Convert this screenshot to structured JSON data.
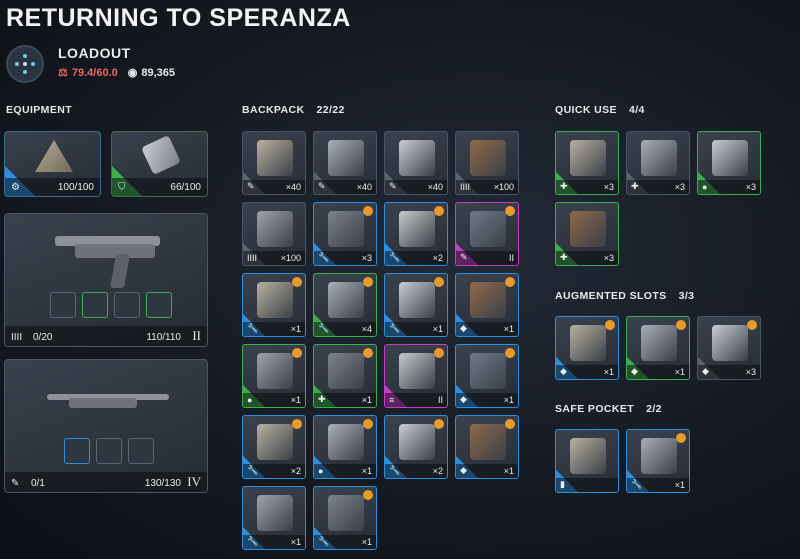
{
  "header": {
    "title": "RETURNING TO SPERANZA",
    "loadout_label": "LOADOUT",
    "weight": "79.4/60.0",
    "coins": "89,365"
  },
  "colors": {
    "blue": "#2f8fdf",
    "green": "#3cae4f",
    "purple": "#c43ec6",
    "gray": "#5b6370",
    "gold": "#e89a2c",
    "weight": "#e76a5c"
  },
  "equipment": {
    "label": "EQUIPMENT",
    "augment": {
      "value": "100/100",
      "icon": "augment-icon"
    },
    "shield": {
      "value": "66/100",
      "icon": "shield-icon"
    },
    "weapon1": {
      "ammo": "0/20",
      "durability": "110/110",
      "tier": "II",
      "mods": [
        "mod-a",
        "mod-b",
        "mod-c",
        "mod-d"
      ]
    },
    "weapon2": {
      "ammo": "0/1",
      "durability": "130/130",
      "tier": "IV",
      "mods": [
        "mod-a",
        "mod-b",
        "mod-c"
      ]
    }
  },
  "backpack": {
    "label": "BACKPACK",
    "count": "22/22",
    "items": [
      {
        "rarity": "gray",
        "qty": "×40",
        "cat": "✎",
        "badge": false
      },
      {
        "rarity": "gray",
        "qty": "×40",
        "cat": "✎",
        "badge": false
      },
      {
        "rarity": "gray",
        "qty": "×40",
        "cat": "✎",
        "badge": false
      },
      {
        "rarity": "gray",
        "qty": "×100",
        "cat": "IIII",
        "badge": false
      },
      {
        "rarity": "gray",
        "qty": "×100",
        "cat": "IIII",
        "badge": false
      },
      {
        "rarity": "blue",
        "qty": "×3",
        "cat": "🔧",
        "badge": true
      },
      {
        "rarity": "blue",
        "qty": "×2",
        "cat": "🔧",
        "badge": true
      },
      {
        "rarity": "purple",
        "qty": "II",
        "cat": "✎",
        "badge": true
      },
      {
        "rarity": "blue",
        "qty": "×1",
        "cat": "🔧",
        "badge": true
      },
      {
        "rarity": "green",
        "qty": "×4",
        "cat": "🔧",
        "badge": true
      },
      {
        "rarity": "blue",
        "qty": "×1",
        "cat": "🔧",
        "badge": true
      },
      {
        "rarity": "blue",
        "qty": "×1",
        "cat": "◆",
        "badge": true
      },
      {
        "rarity": "green",
        "qty": "×1",
        "cat": "●",
        "badge": true
      },
      {
        "rarity": "green",
        "qty": "×1",
        "cat": "✚",
        "badge": true
      },
      {
        "rarity": "purple",
        "qty": "II",
        "cat": "≡",
        "badge": true
      },
      {
        "rarity": "blue",
        "qty": "×1",
        "cat": "◆",
        "badge": true
      },
      {
        "rarity": "blue",
        "qty": "×2",
        "cat": "🔧",
        "badge": true
      },
      {
        "rarity": "blue",
        "qty": "×1",
        "cat": "●",
        "badge": true
      },
      {
        "rarity": "blue",
        "qty": "×2",
        "cat": "🔧",
        "badge": true
      },
      {
        "rarity": "blue",
        "qty": "×1",
        "cat": "◆",
        "badge": true
      },
      {
        "rarity": "blue",
        "qty": "×1",
        "cat": "🔧",
        "badge": false
      },
      {
        "rarity": "blue",
        "qty": "×1",
        "cat": "🔧",
        "badge": true
      }
    ]
  },
  "quick_use": {
    "label": "QUICK USE",
    "count": "4/4",
    "items": [
      {
        "rarity": "green",
        "qty": "×3",
        "cat": "✚",
        "badge": false
      },
      {
        "rarity": "gray",
        "qty": "×3",
        "cat": "✚",
        "badge": false
      },
      {
        "rarity": "green",
        "qty": "×3",
        "cat": "●",
        "badge": false
      },
      {
        "rarity": "green",
        "qty": "×3",
        "cat": "✚",
        "badge": false
      }
    ]
  },
  "augmented": {
    "label": "AUGMENTED SLOTS",
    "count": "3/3",
    "items": [
      {
        "rarity": "blue",
        "qty": "×1",
        "cat": "◆",
        "badge": true
      },
      {
        "rarity": "green",
        "qty": "×1",
        "cat": "◆",
        "badge": true
      },
      {
        "rarity": "gray",
        "qty": "×3",
        "cat": "◆",
        "badge": true
      }
    ]
  },
  "safe_pocket": {
    "label": "SAFE POCKET",
    "count": "2/2",
    "items": [
      {
        "rarity": "blue",
        "qty": "",
        "cat": "▮",
        "badge": false
      },
      {
        "rarity": "blue",
        "qty": "×1",
        "cat": "🔧",
        "badge": true
      }
    ]
  }
}
